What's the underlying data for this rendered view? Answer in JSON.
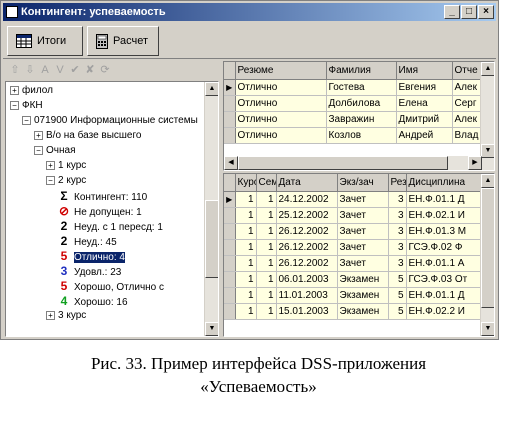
{
  "window": {
    "title": "Контингент: успеваемость",
    "btn_min": "_",
    "btn_max": "□",
    "btn_close": "×"
  },
  "toolbar": {
    "totals_label": "Итоги",
    "calc_label": "Расчет"
  },
  "small_toolbar": {
    "icons": [
      "⇧",
      "⇩",
      "A",
      "V",
      "✔",
      "✘",
      "⟳"
    ]
  },
  "tree": {
    "nodes": [
      {
        "expander": "+",
        "symbol": "",
        "label": "филол",
        "sym_color": "#000000"
      },
      {
        "expander": "−",
        "symbol": "",
        "label": "ФКН",
        "sym_color": "#000000"
      },
      {
        "expander": "−",
        "symbol": "",
        "label": "071900 Информационные системы",
        "sym_color": "#000000"
      },
      {
        "expander": "+",
        "symbol": "",
        "label": "В/о на базе высшего",
        "sym_color": "#000000"
      },
      {
        "expander": "−",
        "symbol": "",
        "label": "Очная",
        "sym_color": "#000000"
      },
      {
        "expander": "+",
        "symbol": "",
        "label": "1 курс",
        "sym_color": "#000000"
      },
      {
        "expander": "−",
        "symbol": "",
        "label": "2 курс",
        "sym_color": "#000000"
      },
      {
        "expander": "",
        "symbol": "Σ",
        "label": "Контингент: 110",
        "sym_color": "#000000"
      },
      {
        "expander": "",
        "symbol": "⊘",
        "label": "Не допущен: 1",
        "sym_color": "#d00000"
      },
      {
        "expander": "",
        "symbol": "2",
        "label": "Неуд. с 1 пересд: 1",
        "sym_color": "#000000"
      },
      {
        "expander": "",
        "symbol": "2",
        "label": "Неуд.: 45",
        "sym_color": "#000000"
      },
      {
        "expander": "",
        "symbol": "5",
        "label": "Отлично: 4",
        "sym_color": "#d00000"
      },
      {
        "expander": "",
        "symbol": "3",
        "label": "Удовл.: 23",
        "sym_color": "#2030c0"
      },
      {
        "expander": "",
        "symbol": "5",
        "label": "Хорошо, Отлично с",
        "sym_color": "#d00000"
      },
      {
        "expander": "",
        "symbol": "4",
        "label": "Хорошо: 16",
        "sym_color": "#10a020"
      },
      {
        "expander": "+",
        "symbol": "",
        "label": "3 курс",
        "sym_color": "#000000"
      }
    ]
  },
  "upper_grid": {
    "columns": [
      "Резюме",
      "Фамилия",
      "Имя",
      "Отче"
    ],
    "rows": [
      [
        "Отлично",
        "Гостева",
        "Евгения",
        "Алек"
      ],
      [
        "Отлично",
        "Долбилова",
        "Елена",
        "Серг"
      ],
      [
        "Отлично",
        "Завражин",
        "Дмитрий",
        "Алек"
      ],
      [
        "Отлично",
        "Козлов",
        "Андрей",
        "Влад"
      ]
    ]
  },
  "lower_grid": {
    "columns": [
      "Курс",
      "Сем",
      "Дата",
      "Экз/зач",
      "Реза",
      "Дисциплина"
    ],
    "rows": [
      [
        "1",
        "1",
        "24.12.2002",
        "Зачет",
        "3",
        "ЕН.Ф.01.1 Д"
      ],
      [
        "1",
        "1",
        "25.12.2002",
        "Зачет",
        "3",
        "ЕН.Ф.02.1 И"
      ],
      [
        "1",
        "1",
        "26.12.2002",
        "Зачет",
        "3",
        "ЕН.Ф.01.3 М"
      ],
      [
        "1",
        "1",
        "26.12.2002",
        "Зачет",
        "3",
        "ГСЭ.Ф.02 Ф"
      ],
      [
        "1",
        "1",
        "26.12.2002",
        "Зачет",
        "3",
        "ЕН.Ф.01.1 А"
      ],
      [
        "1",
        "1",
        "06.01.2003",
        "Экзамен",
        "5",
        "ГСЭ.Ф.03 От"
      ],
      [
        "1",
        "1",
        "11.01.2003",
        "Экзамен",
        "5",
        "ЕН.Ф.01.1 Д"
      ],
      [
        "1",
        "1",
        "15.01.2003",
        "Экзамен",
        "5",
        "ЕН.Ф.02.2 И"
      ]
    ]
  },
  "caption": {
    "line1": "Рис. 33. Пример интерфейса DSS-приложения",
    "line2": "«Успеваемость»"
  }
}
